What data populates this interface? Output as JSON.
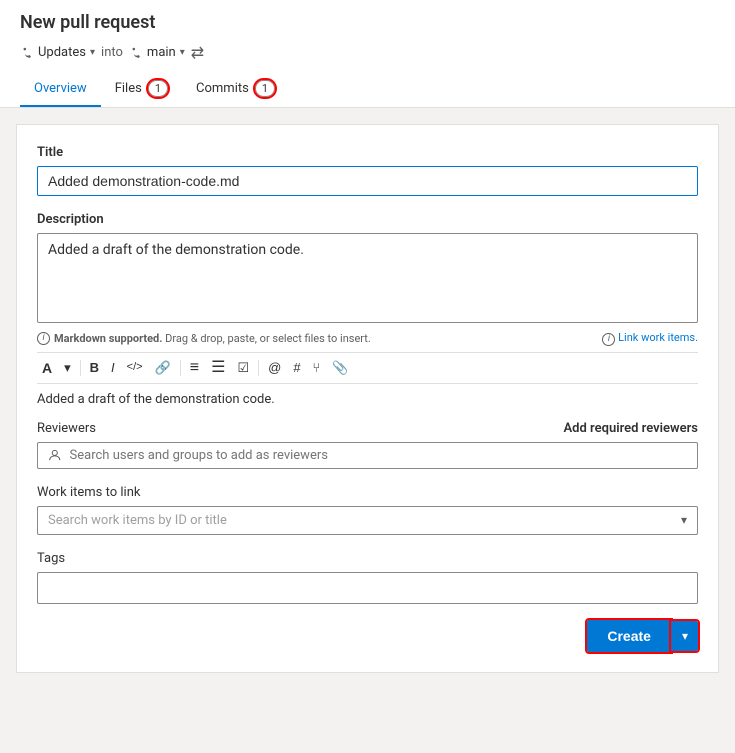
{
  "page": {
    "title": "New pull request"
  },
  "branches": {
    "source": "Updates",
    "into": "into",
    "target": "main"
  },
  "tabs": [
    {
      "id": "overview",
      "label": "Overview",
      "badge": null,
      "active": true
    },
    {
      "id": "files",
      "label": "Files",
      "badge": "1",
      "active": false
    },
    {
      "id": "commits",
      "label": "Commits",
      "badge": "1",
      "active": false
    }
  ],
  "form": {
    "title_label": "Title",
    "title_value": "Added demonstration-code.md",
    "description_label": "Description",
    "description_value": "Added a draft of the demonstration code.",
    "markdown_hint": "Markdown supported.",
    "drag_hint": "Drag & drop, paste, or select files to insert.",
    "link_work_items": "Link work items.",
    "preview_text": "Added a draft of the demonstration code.",
    "reviewers_label": "Reviewers",
    "add_reviewers_label": "Add required reviewers",
    "reviewers_placeholder": "Search users and groups to add as reviewers",
    "work_items_label": "Work items to link",
    "work_items_placeholder": "Search work items by ID or title",
    "tags_label": "Tags",
    "create_label": "Create"
  },
  "toolbar": {
    "items": [
      {
        "id": "heading",
        "icon": "A",
        "title": "Heading"
      },
      {
        "id": "chevron-down",
        "icon": "▾",
        "title": "More"
      },
      {
        "id": "bold",
        "icon": "B",
        "title": "Bold"
      },
      {
        "id": "italic",
        "icon": "I",
        "title": "Italic"
      },
      {
        "id": "code",
        "icon": "</>",
        "title": "Code"
      },
      {
        "id": "link",
        "icon": "🔗",
        "title": "Link"
      },
      {
        "id": "ordered-list",
        "icon": "≡",
        "title": "Ordered list"
      },
      {
        "id": "unordered-list",
        "icon": "☰",
        "title": "Unordered list"
      },
      {
        "id": "task-list",
        "icon": "☑",
        "title": "Task list"
      },
      {
        "id": "mention",
        "icon": "@",
        "title": "Mention"
      },
      {
        "id": "hash",
        "icon": "#",
        "title": "Hash"
      },
      {
        "id": "pullrequest",
        "icon": "⑂",
        "title": "Pull request"
      },
      {
        "id": "attachment",
        "icon": "📎",
        "title": "Attachment"
      }
    ]
  }
}
